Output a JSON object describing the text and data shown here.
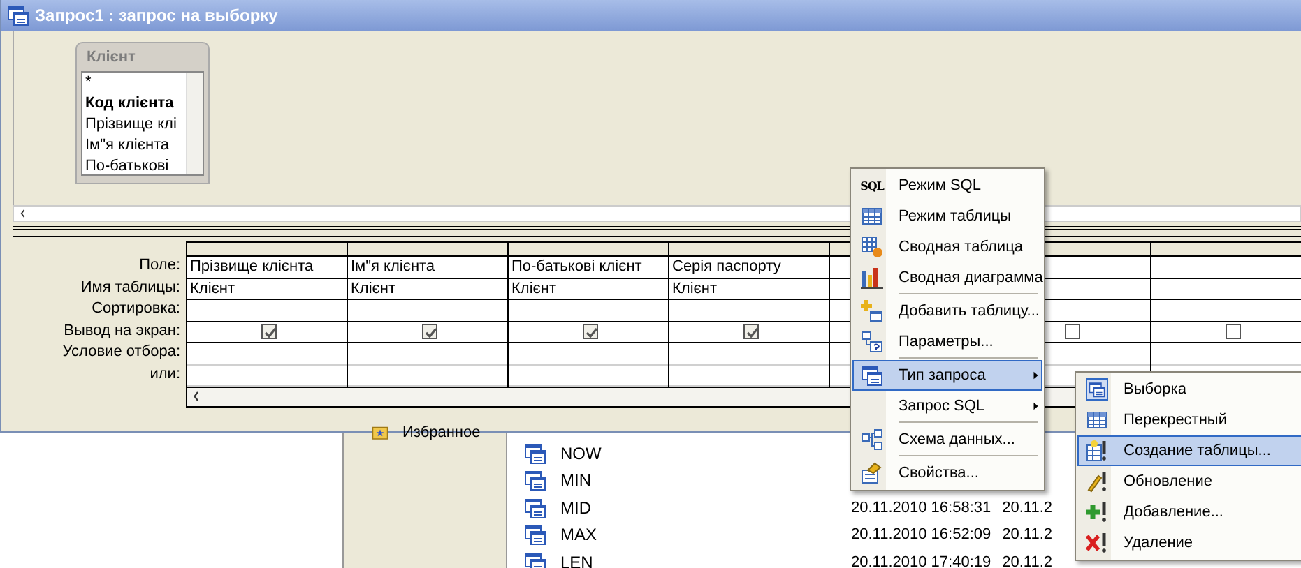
{
  "window": {
    "title": "Запрос1 : запрос на выборку"
  },
  "table_box": {
    "title": "Клієнт",
    "fields": [
      {
        "name": "*",
        "key": false
      },
      {
        "name": "Код клієнта",
        "key": true
      },
      {
        "name": "Прізвище клі",
        "key": false
      },
      {
        "name": "Ім\"я клієнта",
        "key": false
      },
      {
        "name": "По-батькові",
        "key": false
      }
    ]
  },
  "grid": {
    "row_labels": [
      "Поле:",
      "Имя таблицы:",
      "Сортировка:",
      "Вывод на экран:",
      "Условие отбора:",
      "или:"
    ],
    "columns": [
      {
        "field": "Прізвище клієнта",
        "table": "Клієнт",
        "show": true
      },
      {
        "field": "Ім\"я клієнта",
        "table": "Клієнт",
        "show": true
      },
      {
        "field": "По-батькові клієнт",
        "table": "Клієнт",
        "show": true
      },
      {
        "field": "Серія паспорту",
        "table": "Клієнт",
        "show": true
      },
      {},
      {
        "show": false
      },
      {
        "show": false
      }
    ]
  },
  "navigation": {
    "items": [
      "Избранное"
    ]
  },
  "objects": [
    {
      "name": "NOW"
    },
    {
      "name": "MIN"
    },
    {
      "name": "MID",
      "created": "20.11.2010 16:58:31",
      "modified": "20.11.2"
    },
    {
      "name": "MAX",
      "created": "20.11.2010 16:52:09",
      "modified": "20.11.2"
    },
    {
      "name": "LEN",
      "created": "20.11.2010 17:40:19",
      "modified": "20.11.2"
    }
  ],
  "context_menu": [
    {
      "label": "Режим SQL",
      "icon_text": "SQL",
      "selected": false,
      "separator": false
    },
    {
      "label": "Режим таблицы",
      "selected": false,
      "separator": false
    },
    {
      "label": "Сводная таблица",
      "selected": false,
      "separator": false
    },
    {
      "label": "Сводная диаграмма",
      "selected": false,
      "separator": true
    },
    {
      "label": "Добавить таблицу...",
      "selected": false,
      "separator": false
    },
    {
      "label": "Параметры...",
      "selected": false,
      "separator": true
    },
    {
      "label": "Тип запроса",
      "selected": true,
      "submenu": true,
      "separator": false
    },
    {
      "label": "Запрос SQL",
      "selected": false,
      "submenu": true,
      "separator": true
    },
    {
      "label": "Схема данных...",
      "selected": false,
      "separator": true
    },
    {
      "label": "Свойства...",
      "selected": false,
      "separator": false
    }
  ],
  "submenu": [
    {
      "label": "Выборка",
      "selected": false,
      "checked": true
    },
    {
      "label": "Перекрестный",
      "selected": false,
      "checked": false
    },
    {
      "label": "Создание таблицы...",
      "selected": true,
      "checked": false
    },
    {
      "label": "Обновление",
      "selected": false,
      "checked": false
    },
    {
      "label": "Добавление...",
      "selected": false,
      "checked": false
    },
    {
      "label": "Удаление",
      "selected": false,
      "checked": false
    }
  ]
}
